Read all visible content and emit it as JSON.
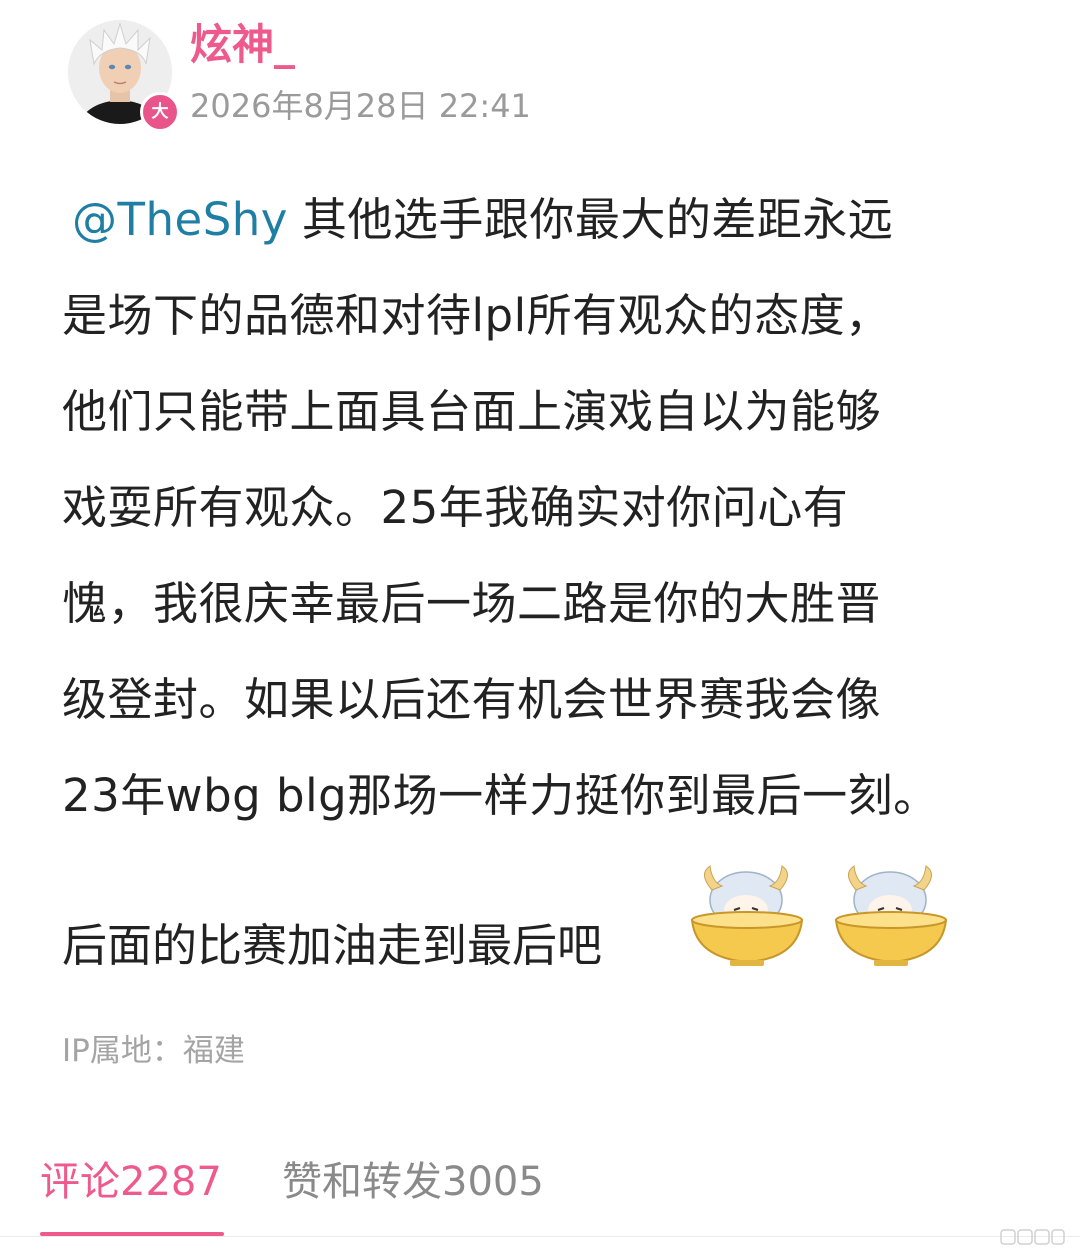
{
  "post": {
    "author": {
      "username": "炫神_",
      "badge": "大",
      "avatar_icon": "user-avatar"
    },
    "timestamp": "2026年8月28日 22:41",
    "mention": "@TheShy",
    "body_lines": [
      "其他选手跟你最大的差距永远",
      "是场下的品德和对待lpl所有观众的态度，",
      "他们只能带上面具台面上演戏自以为能够",
      "戏耍所有观众。25年我确实对你问心有",
      "愧，我很庆幸最后一场二路是你的大胜晋",
      "级登封。如果以后还有机会世界赛我会像",
      "23年wbg blg那场一样力挺你到最后一刻。"
    ],
    "last_line": "后面的比赛加油走到最后吧",
    "stickers": [
      "bowl-girl-sticker",
      "bowl-girl-sticker"
    ],
    "ip_location": "IP属地：福建"
  },
  "tabs": {
    "comments": {
      "label": "评论",
      "count": "2287"
    },
    "likes_reposts": {
      "label": "赞和转发",
      "count": "3005"
    }
  },
  "colors": {
    "accent_pink": "#ee5a8c",
    "mention_blue": "#1f7ea4",
    "text": "#222222",
    "muted": "#9a9a9a"
  }
}
